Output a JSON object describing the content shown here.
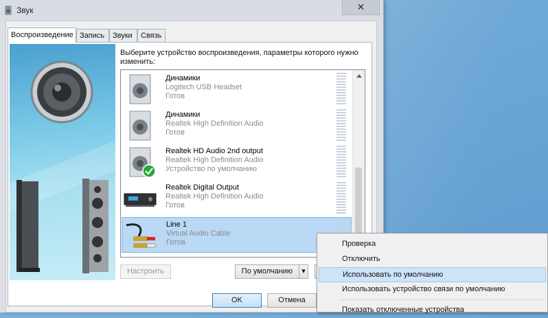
{
  "window": {
    "title": "Звук",
    "close_glyph": "✕"
  },
  "tabs": [
    {
      "label": "Воспроизведение"
    },
    {
      "label": "Запись"
    },
    {
      "label": "Звуки"
    },
    {
      "label": "Связь"
    }
  ],
  "instruction": "Выберите устройство воспроизведения, параметры которого нужно изменить:",
  "devices": [
    {
      "name": "Динамики",
      "description": "Logitech USB Headset",
      "status": "Готов",
      "icon": "speaker-icon"
    },
    {
      "name": "Динамики",
      "description": "Realtek High Definition Audio",
      "status": "Готов",
      "icon": "speaker-icon"
    },
    {
      "name": "Realtek HD Audio 2nd output",
      "description": "Realtek High Definition Audio",
      "status": "Устройство по умолчанию",
      "icon": "speaker-default-icon"
    },
    {
      "name": "Realtek Digital Output",
      "description": "Realtek High Definition Audio",
      "status": "Готов",
      "icon": "digital-output-icon"
    },
    {
      "name": "Line 1",
      "description": "Virtual Audio Cable",
      "status": "Готов",
      "icon": "rca-cable-icon",
      "selected": true
    }
  ],
  "buttons": {
    "configure": "Настроить",
    "set_default": "По умолчанию",
    "ok": "OK",
    "cancel": "Отмена"
  },
  "context_menu": [
    {
      "label": "Проверка"
    },
    {
      "label": "Отключить"
    },
    {
      "label": "Использовать по умолчанию",
      "hover": true
    },
    {
      "label": "Использовать устройство связи по умолчанию"
    },
    {
      "label": "Показать отключенные устройства"
    }
  ],
  "colors": {
    "selection": "#b9d9f5",
    "menu_hover": "#cde4f7",
    "desktop": "#6ea8d6"
  }
}
